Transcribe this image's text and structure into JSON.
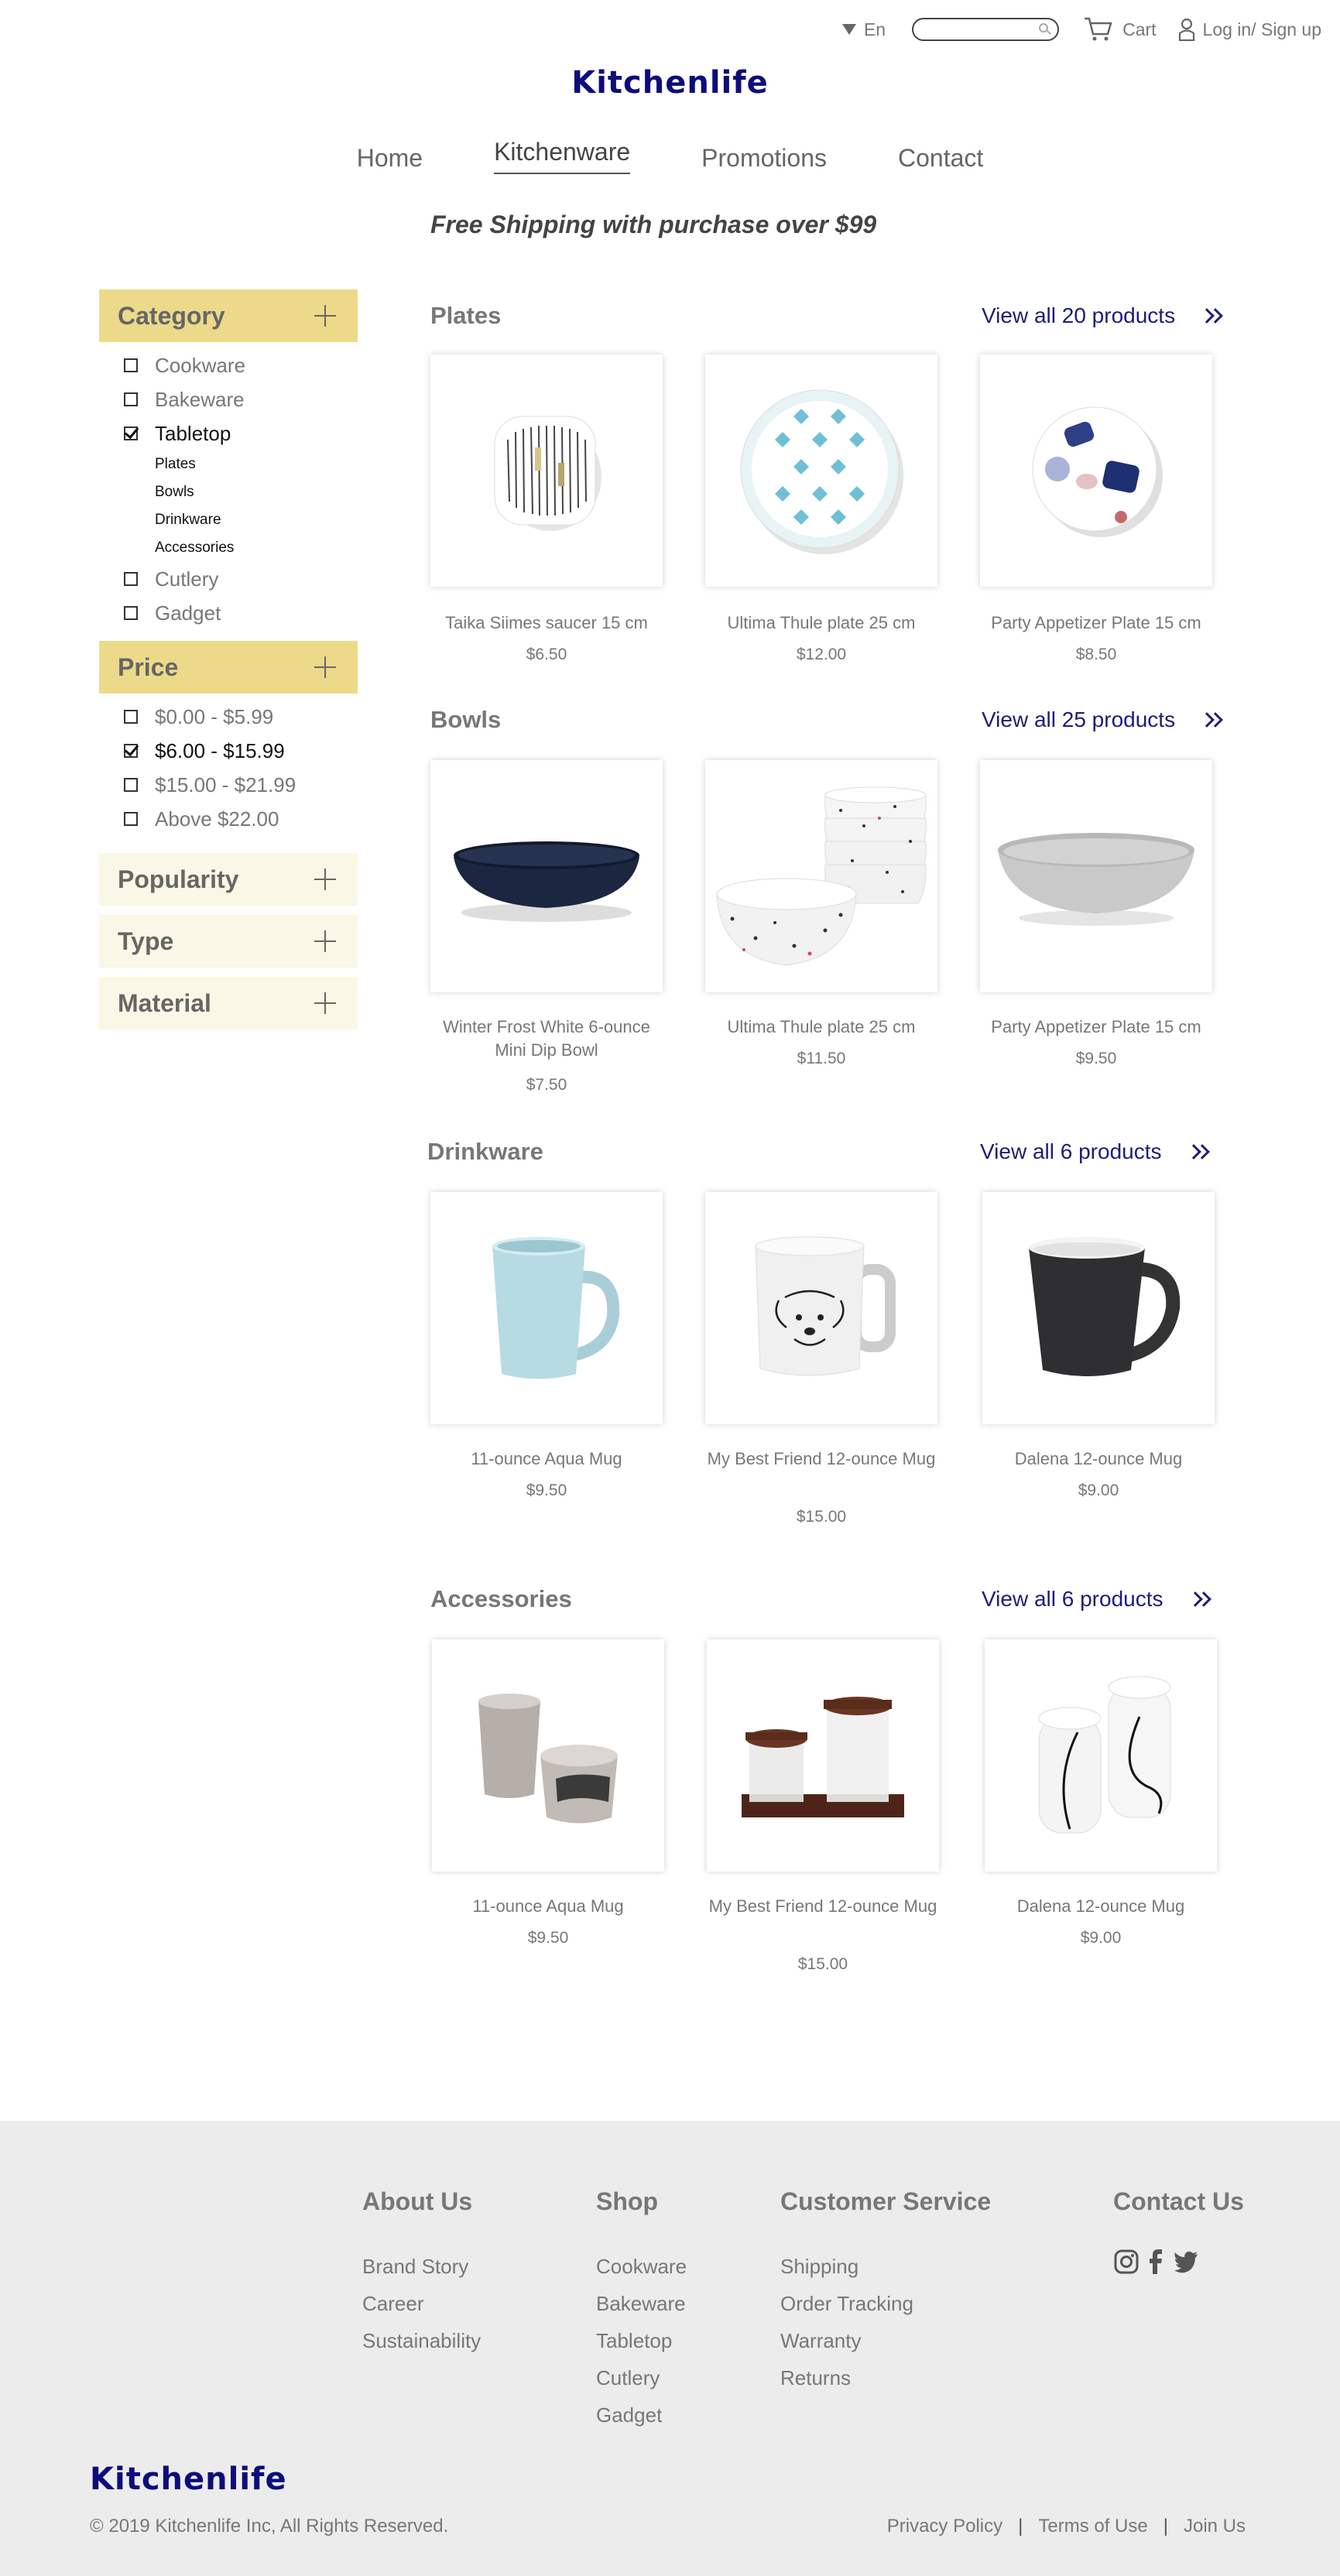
{
  "topbar": {
    "lang": "En",
    "cart": "Cart",
    "login": "Log in/ Sign up",
    "search_placeholder": ""
  },
  "brand": "Kitchenlife",
  "nav": [
    {
      "label": "Home",
      "active": false
    },
    {
      "label": "Kitchenware",
      "active": true
    },
    {
      "label": "Promotions",
      "active": false
    },
    {
      "label": "Contact",
      "active": false
    }
  ],
  "promo": "Free Shipping with purchase over $99",
  "sidebar": {
    "category": {
      "title": "Category",
      "options": [
        {
          "label": "Cookware",
          "checked": false
        },
        {
          "label": "Bakeware",
          "checked": false
        },
        {
          "label": "Tabletop",
          "checked": true
        },
        {
          "label": "Cutlery",
          "checked": false
        },
        {
          "label": "Gadget",
          "checked": false
        }
      ],
      "sub": [
        "Plates",
        "Bowls",
        "Drinkware",
        "Accessories"
      ]
    },
    "price": {
      "title": "Price",
      "options": [
        {
          "label": "$0.00 - $5.99",
          "checked": false
        },
        {
          "label": "$6.00 - $15.99",
          "checked": true
        },
        {
          "label": "$15.00 - $21.99",
          "checked": false
        },
        {
          "label": "Above $22.00",
          "checked": false
        }
      ]
    },
    "filters": [
      "Popularity",
      "Type",
      "Material"
    ]
  },
  "sections": [
    {
      "title": "Plates",
      "viewall": "View all 20 products",
      "products": [
        {
          "name": "Taika Siimes saucer 15 cm",
          "price": "$6.50"
        },
        {
          "name": "Ultima Thule plate 25 cm",
          "price": "$12.00"
        },
        {
          "name": "Party Appetizer Plate 15 cm",
          "price": "$8.50"
        }
      ]
    },
    {
      "title": "Bowls",
      "viewall": "View all 25 products",
      "products": [
        {
          "name": "Winter Frost White 6-ounce Mini Dip Bowl",
          "price": "$7.50"
        },
        {
          "name": "Ultima Thule plate 25 cm",
          "price": "$11.50"
        },
        {
          "name": "Party Appetizer Plate 15 cm",
          "price": "$9.50"
        }
      ]
    },
    {
      "title": "Drinkware",
      "viewall": "View all 6 products",
      "products": [
        {
          "name": "11-ounce Aqua Mug",
          "price": "$9.50"
        },
        {
          "name": "My Best Friend 12-ounce Mug",
          "price": "$15.00"
        },
        {
          "name": "Dalena 12-ounce Mug",
          "price": "$9.00"
        }
      ]
    },
    {
      "title": "Accessories",
      "viewall": "View all 6 products",
      "products": [
        {
          "name": "11-ounce Aqua Mug",
          "price": "$9.50"
        },
        {
          "name": "My Best Friend 12-ounce Mug",
          "price": "$15.00"
        },
        {
          "name": "Dalena 12-ounce Mug",
          "price": "$9.00"
        }
      ]
    }
  ],
  "footer": {
    "about": {
      "title": "About Us",
      "links": [
        "Brand Story",
        "Career",
        "Sustainability"
      ]
    },
    "shop": {
      "title": "Shop",
      "links": [
        "Cookware",
        "Bakeware",
        "Tabletop",
        "Cutlery",
        "Gadget"
      ]
    },
    "service": {
      "title": "Customer Service",
      "links": [
        "Shipping",
        "Order Tracking",
        "Warranty",
        "Returns"
      ]
    },
    "contact": {
      "title": "Contact Us",
      "icons": [
        "instagram-icon",
        "facebook-icon",
        "twitter-icon"
      ]
    },
    "copyright": "© 2019 Kitchenlife Inc, All Rights Reserved.",
    "legal": [
      "Privacy Policy",
      "Terms of Use",
      "Join Us"
    ]
  },
  "colors": {
    "accent": "#edd98a",
    "accent_light": "#fbf7e6",
    "brand": "#0d0d7a",
    "link": "#1d1d7a",
    "footer_bg": "#ececec"
  }
}
